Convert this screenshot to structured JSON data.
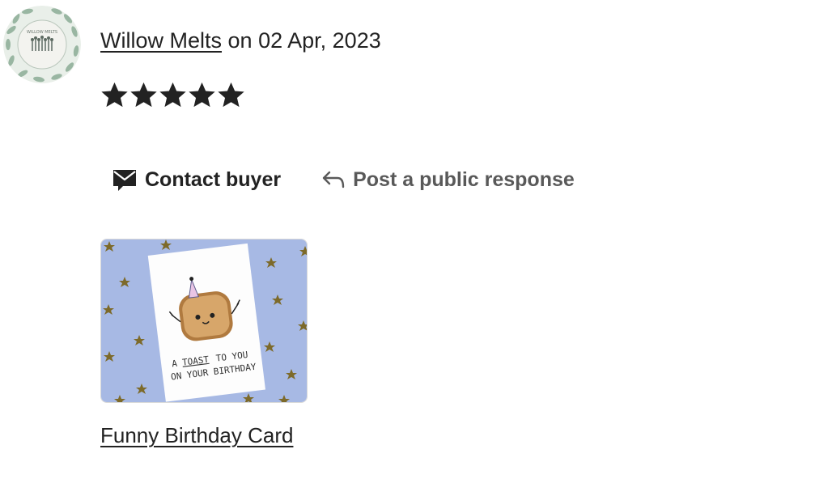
{
  "reviewer": {
    "name": "Willow Melts",
    "date_prefix": "on",
    "date": "02 Apr, 2023",
    "avatar_icon": "shop-logo-avatar",
    "avatar_logo_text": "WILLOW MELTS"
  },
  "rating": {
    "value": 5,
    "max": 5,
    "star_icon": "star-icon"
  },
  "actions": {
    "contact_label": "Contact buyer",
    "contact_icon": "mail-icon",
    "respond_label": "Post a public response",
    "respond_icon": "reply-arrow-icon"
  },
  "listing": {
    "title": "Funny Birthday Card",
    "card_line1_a": "A",
    "card_line1_b": "TOAST",
    "card_line1_c": "TO YOU",
    "card_line2": "ON YOUR BIRTHDAY"
  },
  "colors": {
    "text": "#222222",
    "muted_text": "#595959",
    "thumb_background": "#a7b9e4",
    "star_fill": "#222222"
  }
}
